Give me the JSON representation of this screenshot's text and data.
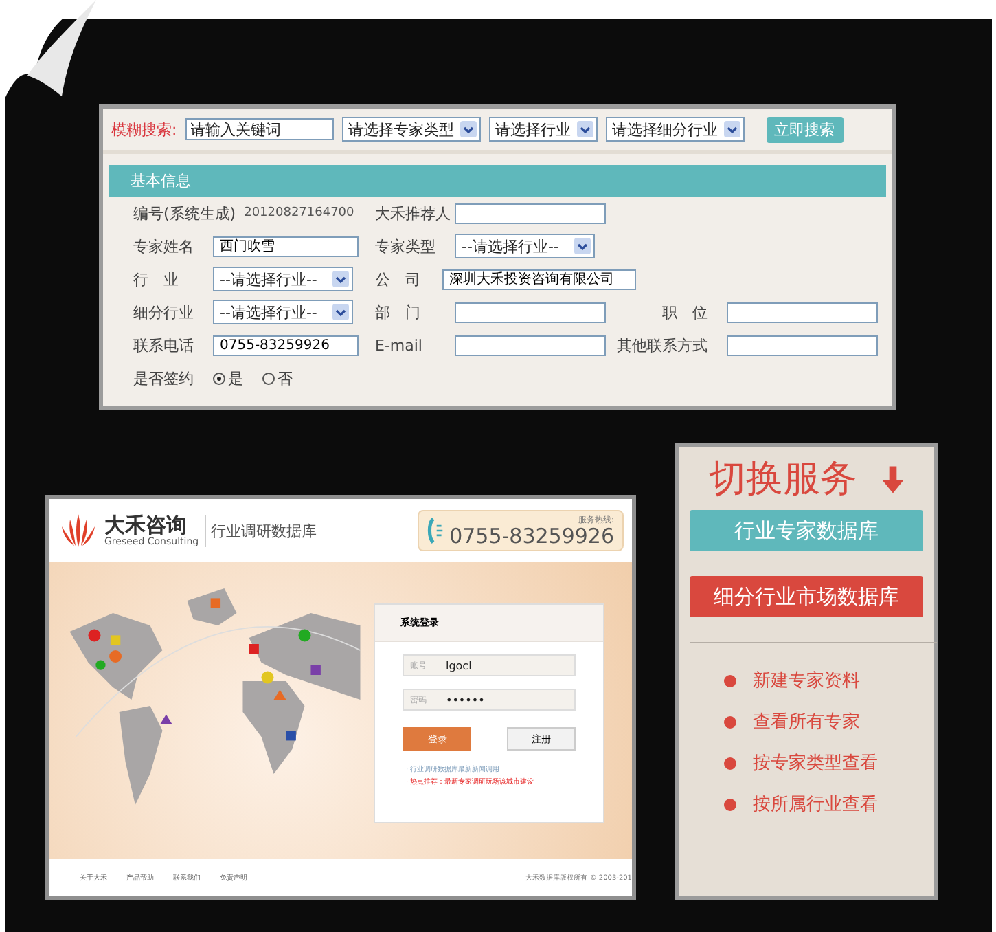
{
  "search": {
    "label": "模糊搜索:",
    "keyword_placeholder": "请输入关键词",
    "selects": [
      "请选择专家类型",
      "请选择行业",
      "请选择细分行业"
    ],
    "button": "立即搜索"
  },
  "form": {
    "title": "基本信息",
    "rows": [
      [
        {
          "label": "编号(系统生成)",
          "kind": "static",
          "value": "20120827164700"
        },
        {
          "label": "大禾推荐人",
          "kind": "input"
        }
      ],
      [
        {
          "label": "专家姓名",
          "kind": "input",
          "value": "西门吹雪"
        },
        {
          "label": "专家类型",
          "kind": "select",
          "value": "--请选择行业--"
        }
      ],
      [
        {
          "label": "行　业",
          "kind": "select",
          "value": "--请选择行业--"
        },
        {
          "label": "公　司",
          "kind": "input",
          "value": "深圳大禾投资咨询有限公司"
        }
      ],
      [
        {
          "label": "细分行业",
          "kind": "select",
          "value": "--请选择行业--"
        },
        {
          "label": "部　门",
          "kind": "input"
        },
        {
          "label": "职　位",
          "kind": "input"
        }
      ],
      [
        {
          "label": "联系电话",
          "kind": "input",
          "value": "0755-83259926"
        },
        {
          "label": "E-mail",
          "kind": "input"
        },
        {
          "label": "其他联系方式",
          "kind": "input"
        }
      ],
      [
        {
          "label": "是否签约",
          "kind": "radio",
          "options": [
            {
              "label": "是",
              "selected": true
            },
            {
              "label": "否",
              "selected": false
            }
          ]
        }
      ]
    ]
  },
  "login_screen": {
    "brand": "大禾咨询",
    "brand_en": "Greseed Consulting",
    "product": "行业调研数据库",
    "hotline_label": "服务热线:",
    "hotline": "0755-83259926",
    "login_title": "系统登录",
    "account_label": "账号",
    "account": "lgocl",
    "password_label": "密码",
    "password": "••••••",
    "login_button": "登录",
    "register_button": "注册",
    "notes": [
      {
        "text": "· 行业调研数据库最新新闻调用",
        "highlight": false
      },
      {
        "text": "· 热点推荐：最新专家调研玩场该城市建设",
        "highlight": true
      }
    ],
    "footer_links": [
      "关于大禾",
      "产品帮助",
      "联系我们",
      "免责声明"
    ],
    "copyright": "大禾数据库版权所有 © 2003-201"
  },
  "service_panel": {
    "title": "切换服务",
    "buttons": [
      {
        "label": "行业专家数据库",
        "color": "#5fb8bb"
      },
      {
        "label": "细分行业市场数据库",
        "color": "#d9483e"
      }
    ],
    "links": [
      "新建专家资料",
      "查看所有专家",
      "按专家类型查看",
      "按所属行业查看"
    ]
  }
}
